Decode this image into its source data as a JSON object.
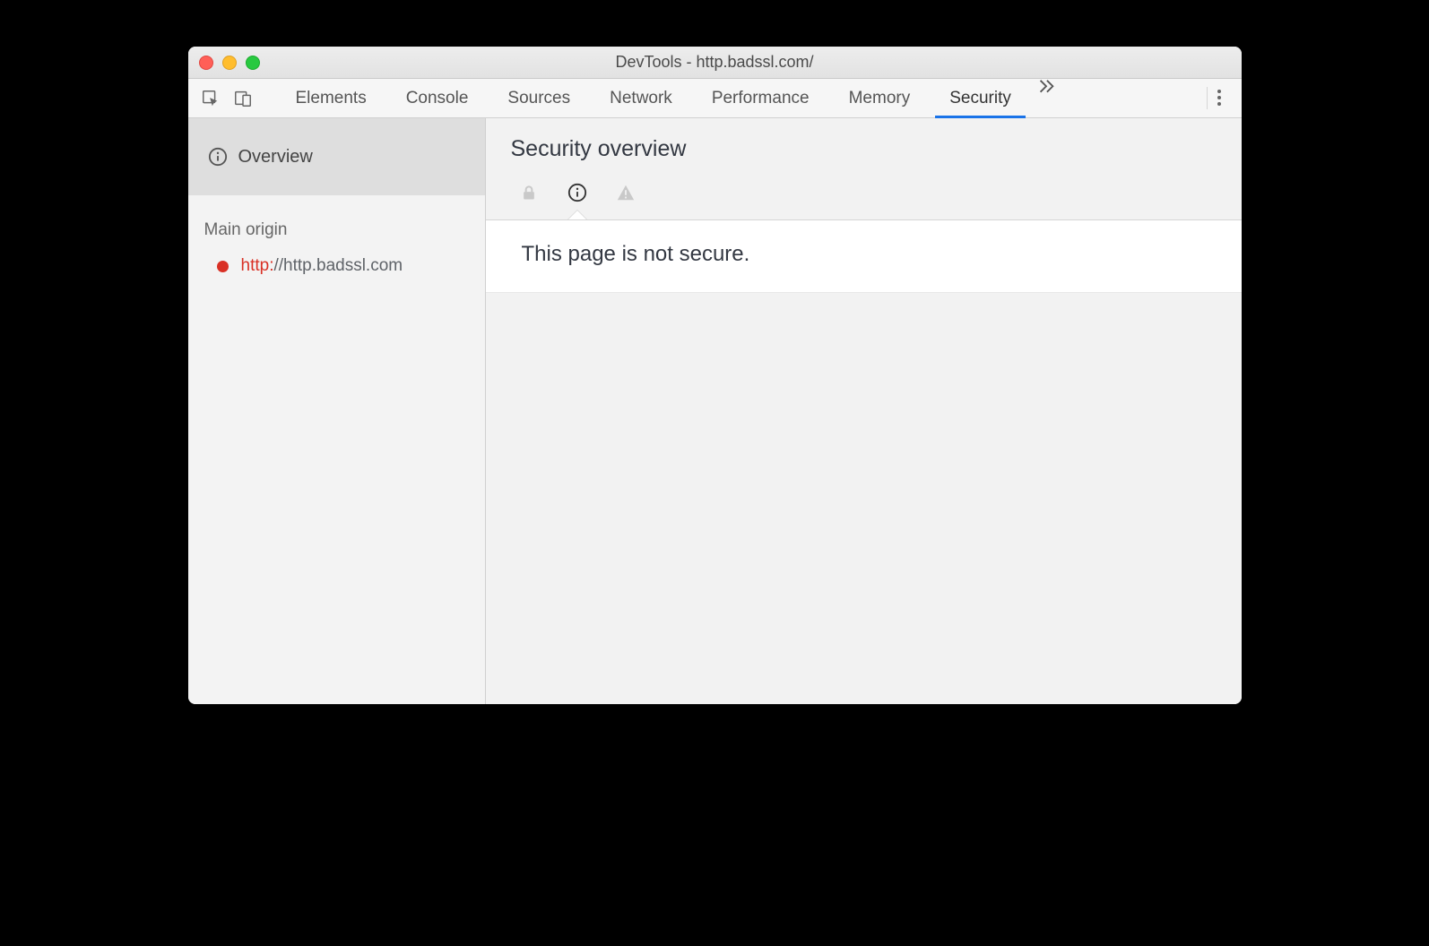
{
  "window": {
    "title": "DevTools - http.badssl.com/"
  },
  "toolbar": {
    "tabs": [
      {
        "label": "Elements"
      },
      {
        "label": "Console"
      },
      {
        "label": "Sources"
      },
      {
        "label": "Network"
      },
      {
        "label": "Performance"
      },
      {
        "label": "Memory"
      },
      {
        "label": "Security",
        "active": true
      }
    ]
  },
  "sidebar": {
    "overview_label": "Overview",
    "main_origin_header": "Main origin",
    "origin": {
      "scheme": "http:",
      "rest": "//http.badssl.com"
    }
  },
  "main": {
    "title": "Security overview",
    "message": "This page is not secure."
  }
}
